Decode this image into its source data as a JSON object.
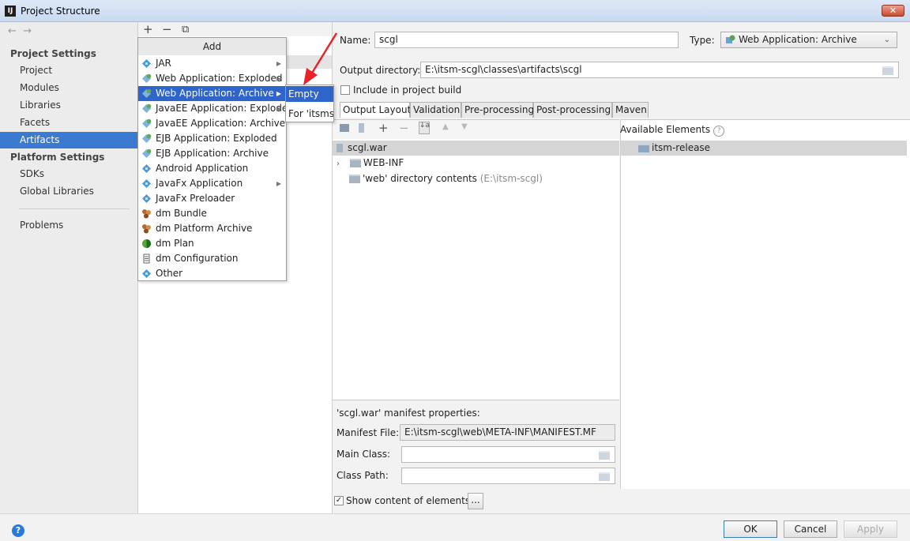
{
  "window": {
    "title": "Project Structure",
    "close_label": "✕"
  },
  "left_nav": {
    "project_settings_header": "Project Settings",
    "project_settings_items": [
      "Project",
      "Modules",
      "Libraries",
      "Facets",
      "Artifacts"
    ],
    "platform_settings_header": "Platform Settings",
    "platform_settings_items": [
      "SDKs",
      "Global Libraries"
    ],
    "problems": "Problems",
    "selected": "Artifacts"
  },
  "mid_toolbar": {
    "add": "+",
    "remove": "−",
    "copy": "⧉"
  },
  "add_menu": {
    "header": "Add",
    "items": [
      {
        "label": "JAR",
        "has_submenu": true
      },
      {
        "label": "Web Application: Exploded",
        "has_submenu": true
      },
      {
        "label": "Web Application: Archive",
        "has_submenu": true,
        "selected": true
      },
      {
        "label": "JavaEE Application: Exploded",
        "has_submenu": true
      },
      {
        "label": "JavaEE Application: Archive",
        "has_submenu": false
      },
      {
        "label": "EJB Application: Exploded",
        "has_submenu": false
      },
      {
        "label": "EJB Application: Archive",
        "has_submenu": false
      },
      {
        "label": "Android Application",
        "has_submenu": false
      },
      {
        "label": "JavaFx Application",
        "has_submenu": true
      },
      {
        "label": "JavaFx Preloader",
        "has_submenu": false
      },
      {
        "label": "dm Bundle",
        "has_submenu": false
      },
      {
        "label": "dm Platform Archive",
        "has_submenu": false
      },
      {
        "label": "dm Plan",
        "has_submenu": false
      },
      {
        "label": "dm Configuration",
        "has_submenu": false
      },
      {
        "label": "Other",
        "has_submenu": false
      }
    ]
  },
  "submenu": {
    "items": [
      "Empty",
      "For 'itsms'"
    ],
    "selected": "Empty"
  },
  "artifact": {
    "name_label": "Name:",
    "name_value": "scgl",
    "type_label": "Type:",
    "type_value": "Web Application: Archive",
    "output_dir_label": "Output directory:",
    "output_dir_value": "E:\\itsm-scgl\\classes\\artifacts\\scgl",
    "include_label": "Include in project build",
    "include_checked": false
  },
  "tabs": [
    "Output Layout",
    "Validation",
    "Pre-processing",
    "Post-processing",
    "Maven"
  ],
  "selected_tab": "Output Layout",
  "tree": {
    "root": "scgl.war",
    "children": [
      {
        "label": "WEB-INF",
        "expandable": true
      },
      {
        "label": "'web' directory contents",
        "suffix": "(E:\\itsm-scgl)"
      }
    ]
  },
  "available": {
    "header": "Available Elements",
    "items": [
      "itsm-release"
    ]
  },
  "manifest": {
    "title": "'scgl.war' manifest properties:",
    "file_label": "Manifest File:",
    "file_value": "E:\\itsm-scgl\\web\\META-INF\\MANIFEST.MF",
    "main_class_label": "Main Class:",
    "main_class_value": "",
    "class_path_label": "Class Path:",
    "class_path_value": ""
  },
  "show_content": {
    "label": "Show content of elements",
    "checked": true,
    "more_label": "..."
  },
  "buttons": {
    "ok": "OK",
    "cancel": "Cancel",
    "apply": "Apply"
  },
  "help": "?",
  "colors": {
    "selection": "#2f65ca",
    "nav_selection": "#3a7bd1",
    "arrow": "#e8232a"
  }
}
